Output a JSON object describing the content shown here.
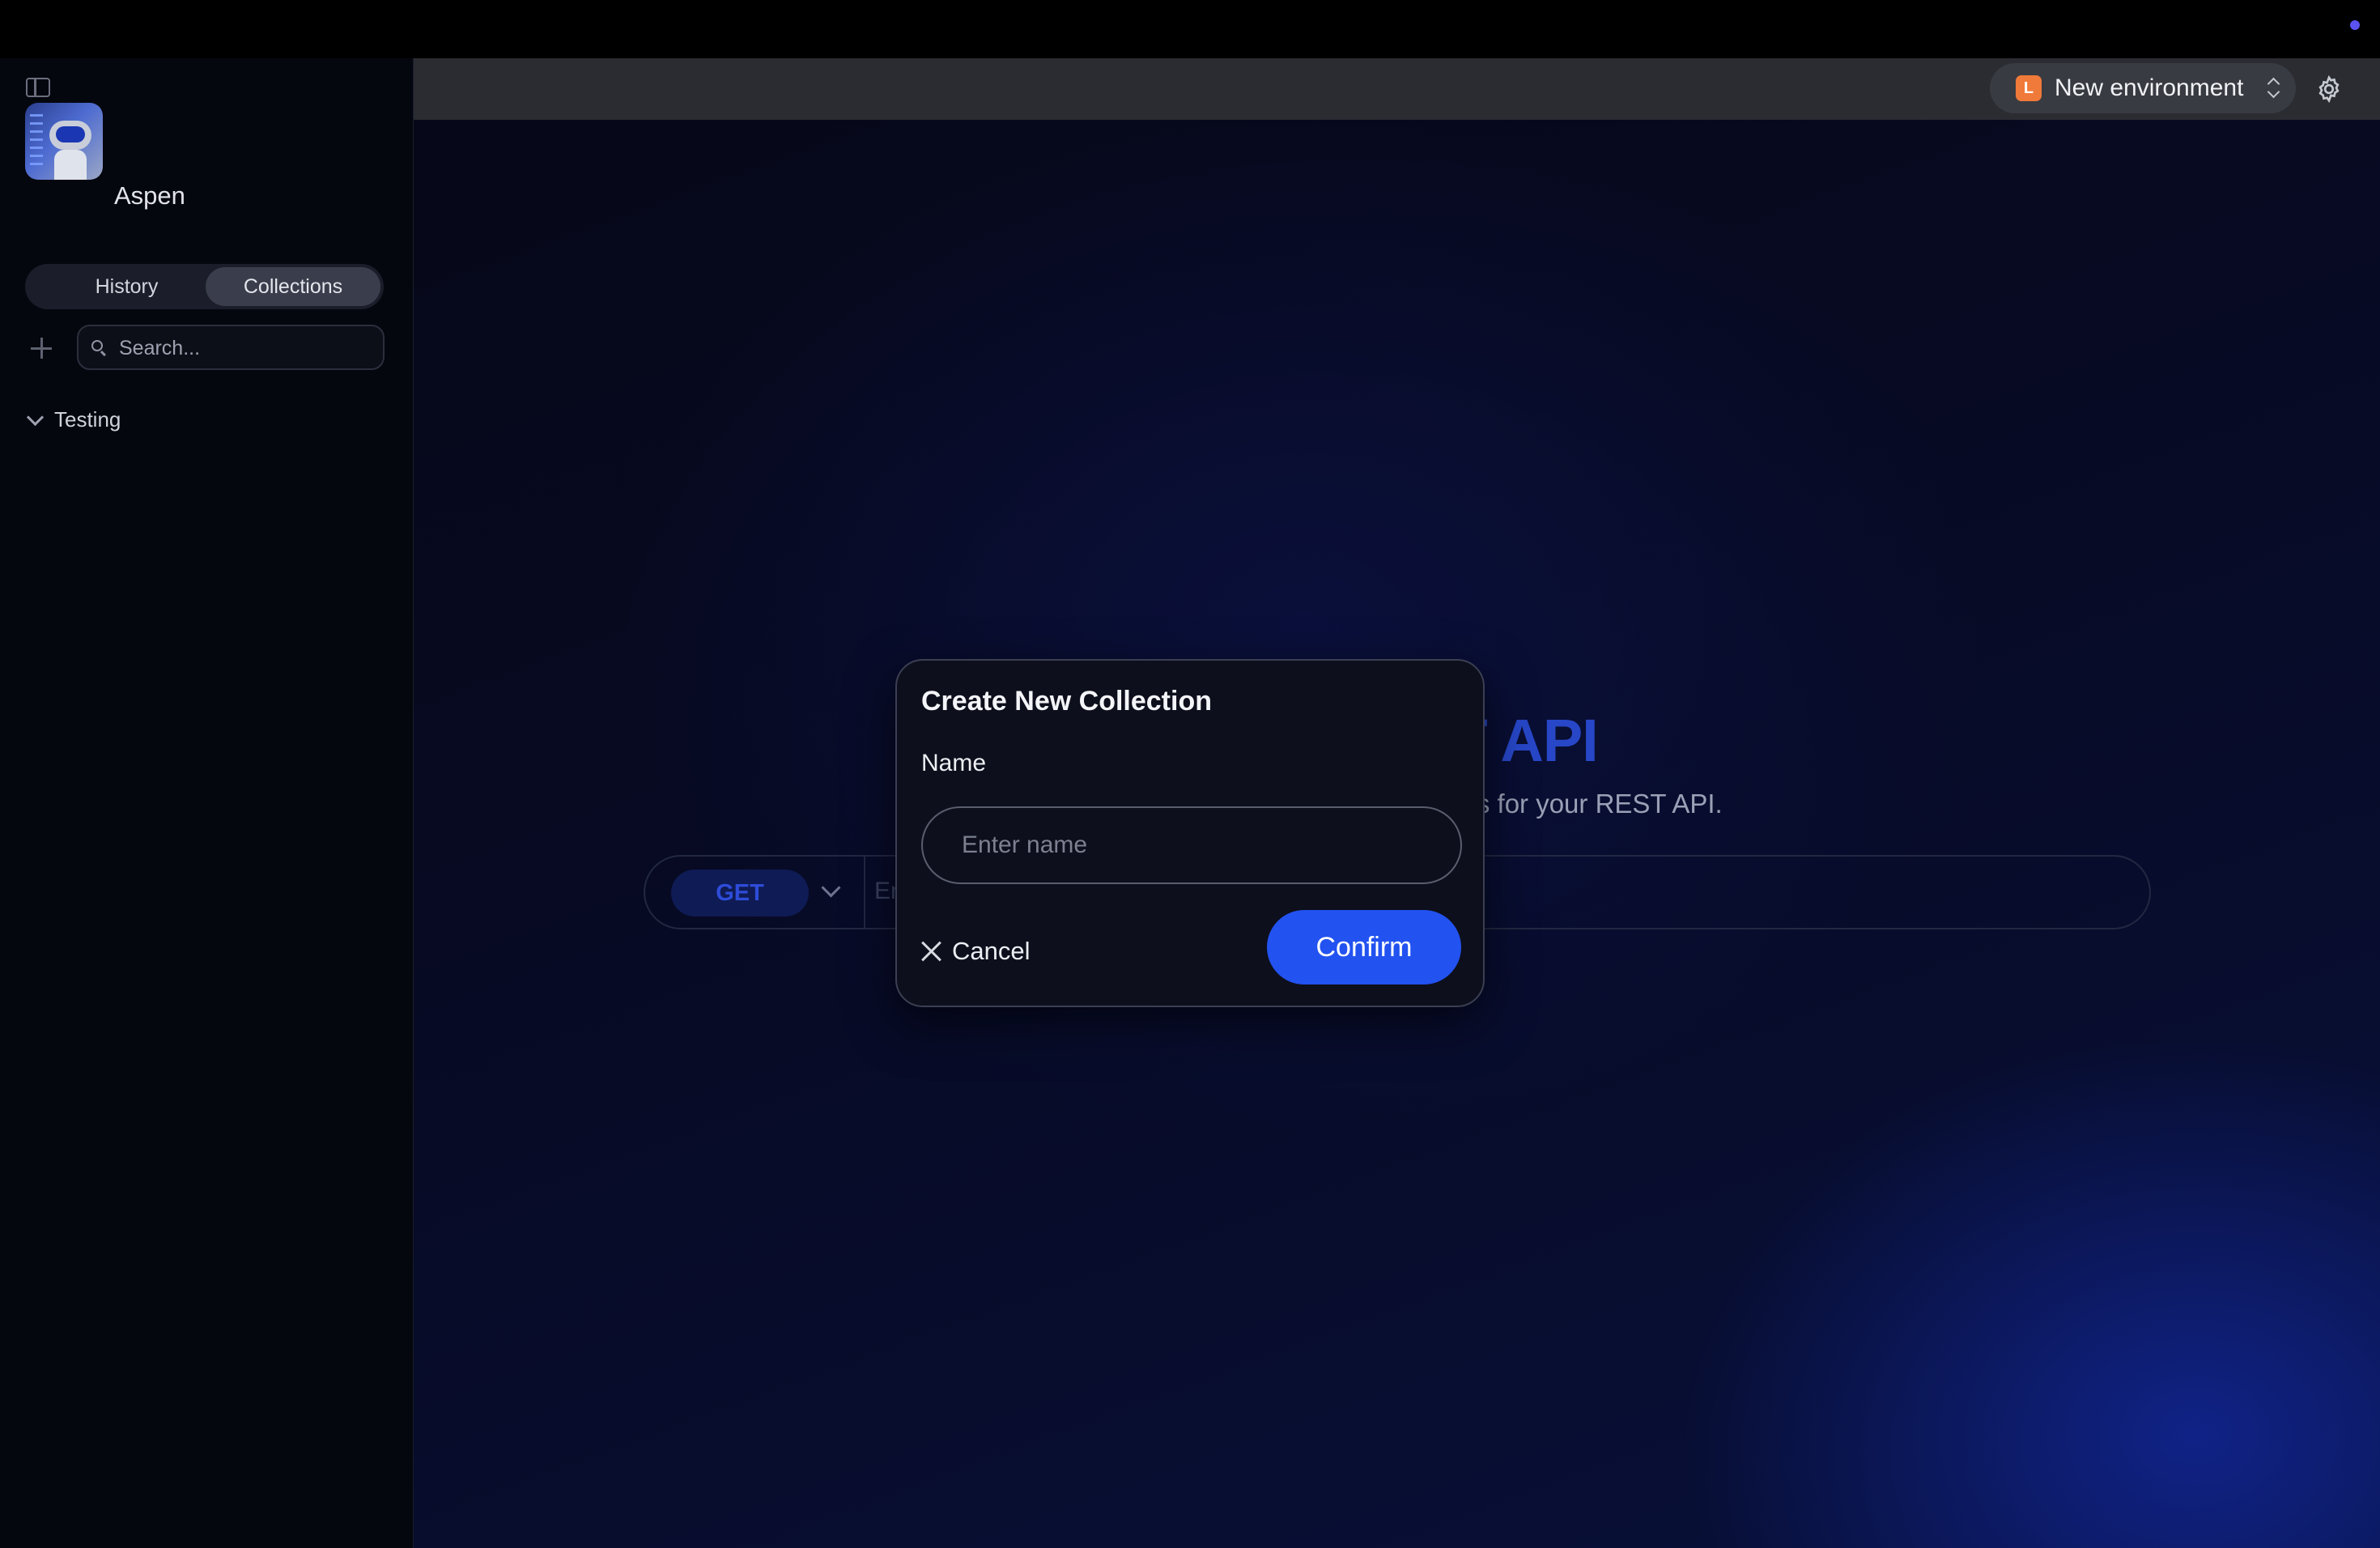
{
  "sidebar": {
    "app_name": "Aspen",
    "tabs": [
      {
        "label": "History",
        "active": false
      },
      {
        "label": "Collections",
        "active": true
      }
    ],
    "search": {
      "placeholder": "Search...",
      "value": ""
    },
    "collections": [
      {
        "label": "Testing",
        "expanded": true
      }
    ]
  },
  "header": {
    "environment": {
      "badge": "L",
      "name": "New environment",
      "badge_color": "#f07a3a"
    }
  },
  "main": {
    "hero_title_visible": "ST API",
    "hero_subtitle_visible": "ults for your REST API.",
    "request": {
      "method": "GET",
      "url_fragment": "Er"
    }
  },
  "dialog": {
    "title": "Create New Collection",
    "name_label": "Name",
    "name_placeholder": "Enter name",
    "name_value": "",
    "cancel_label": "Cancel",
    "confirm_label": "Confirm"
  },
  "colors": {
    "accent": "#2252f0",
    "sidebar_bg": "#05070f",
    "header_bg": "#2a2c32"
  }
}
